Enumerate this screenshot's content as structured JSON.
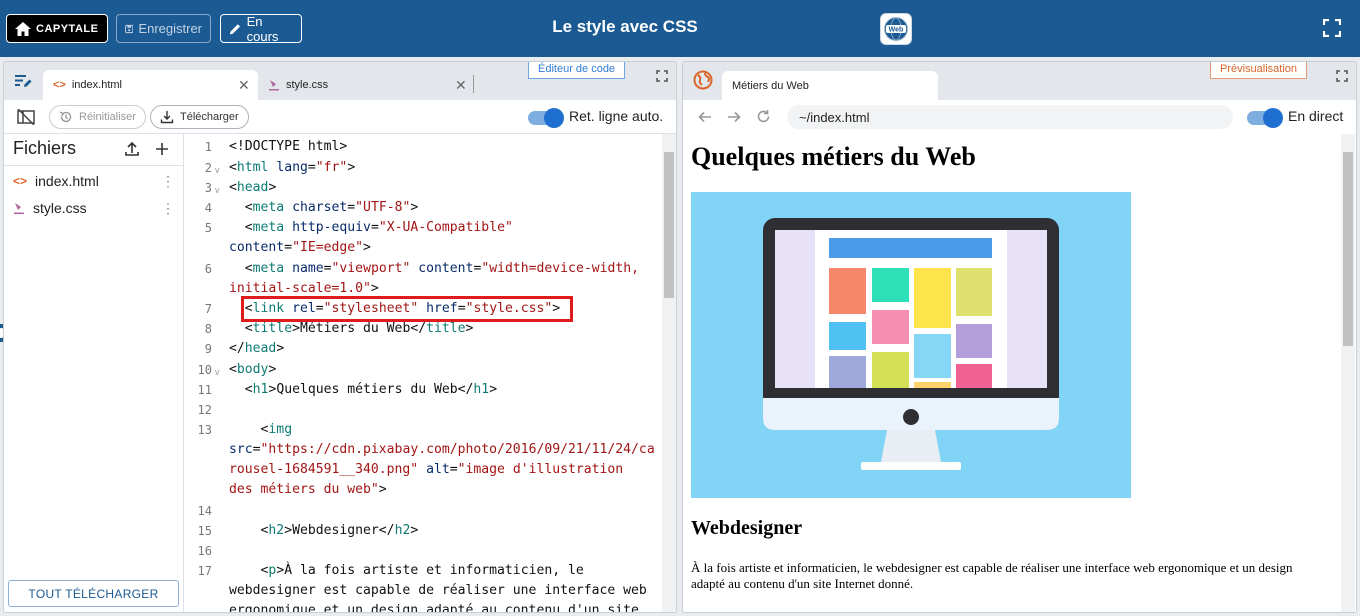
{
  "topbar": {
    "home_logo": "CAPYTALE",
    "save_label": "Enregistrer",
    "progress_label": "En cours",
    "title": "Le style avec CSS",
    "badge_text": "Web"
  },
  "editor": {
    "tab_active": "index.html",
    "tab_other": "style.css",
    "panel_label": "Éditeur de code",
    "reset_label": "Réinitialiser",
    "download_label": "Télécharger",
    "wrap_label": "Ret. ligne auto.",
    "files_title": "Fichiers",
    "files": [
      {
        "name": "index.html"
      },
      {
        "name": "style.css"
      }
    ],
    "download_all": "TOUT TÉLÉCHARGER",
    "line_numbers": [
      "1",
      "2",
      "3",
      "4",
      "5",
      "6",
      "7",
      "8",
      "9",
      "10",
      "11",
      "12",
      "13",
      "14",
      "15",
      "16",
      "17"
    ]
  },
  "preview": {
    "panel_label": "Prévisualisation",
    "tab_title": "Métiers du Web",
    "address": "~/index.html",
    "live_label": "En direct",
    "h1": "Quelques métiers du Web",
    "h2": "Webdesigner",
    "paragraph": "À la fois artiste et informaticien, le webdesigner est capable de réaliser une interface web ergonomique et un design adapté au contenu d'un site Internet donné."
  },
  "colors": {
    "header": "#1b5a93",
    "accent": "#1f6fd1",
    "highlight": "#e01b1b",
    "editor_label": "#4a90d9",
    "preview_label": "#d9652b"
  }
}
